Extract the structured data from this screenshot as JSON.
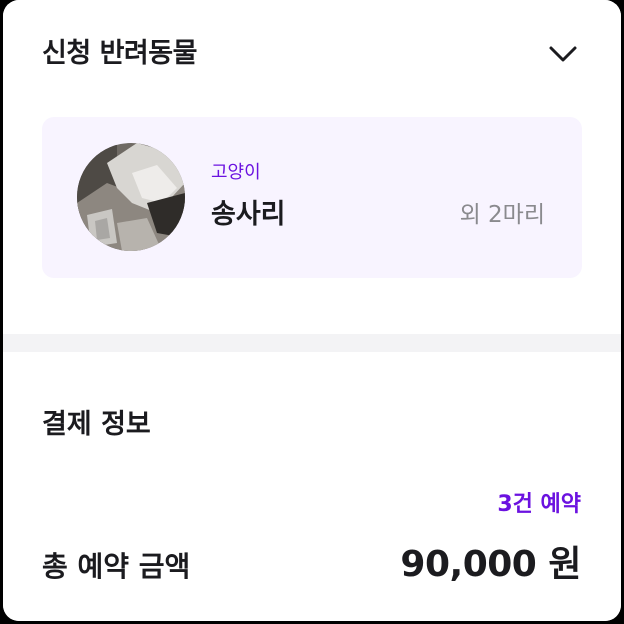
{
  "applicant_pets": {
    "title": "신청 반려동물",
    "toggle_icon": "chevron-down-icon",
    "pet": {
      "avatar_icon": "pet-photo",
      "type": "고양이",
      "name": "송사리",
      "more": "외 2마리"
    }
  },
  "payment": {
    "title": "결제 정보",
    "reservation_count": "3건 예약",
    "total_label": "총 예약 금액",
    "total_amount": "90,000 원"
  },
  "colors": {
    "accent": "#6b12e0",
    "pet_card_bg": "#f8f4ff",
    "text_primary": "#1b1b1f",
    "text_secondary": "#8a8a8e",
    "divider": "#f3f3f5"
  }
}
